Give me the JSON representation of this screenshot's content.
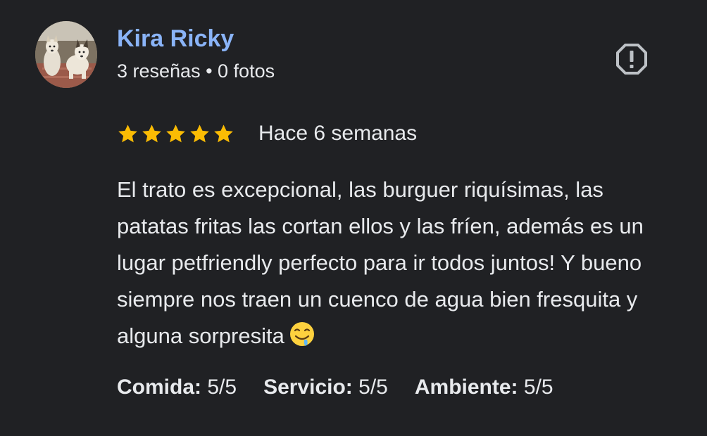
{
  "review": {
    "author": {
      "name": "Kira Ricky",
      "meta": "3 reseñas • 0 fotos",
      "avatar_icon": "profile-photo-two-dogs"
    },
    "report_icon": "report-flag-icon",
    "rating": {
      "stars": 5,
      "max_stars": 5,
      "star_color": "#fbbc04"
    },
    "date": "Hace 6 semanas",
    "text": "El trato es excepcional, las burguer riquísimas, las patatas fritas las cortan ellos y las fríen, además es un lugar petfriendly perfecto para ir todos juntos! Y bueno siempre nos traen un cuenco de agua bien fresquita y alguna sorpresita",
    "text_emoji": "drooling-face-emoji",
    "sub_ratings": [
      {
        "label": "Comida:",
        "value": "5/5"
      },
      {
        "label": "Servicio:",
        "value": "5/5"
      },
      {
        "label": "Ambiente:",
        "value": "5/5"
      }
    ]
  },
  "colors": {
    "background": "#202124",
    "author_link": "#8ab4f8",
    "text": "#e8eaed",
    "icon": "#bdc1c6"
  }
}
